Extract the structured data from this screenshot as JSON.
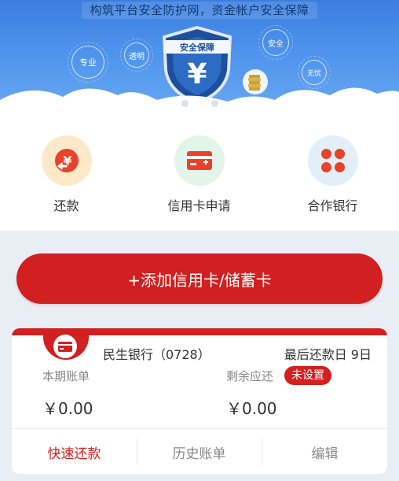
{
  "banner": {
    "title": "构筑平台安全防护网，资金帐户安全保障",
    "shield_text": "安全保障",
    "shield_symbol": "¥",
    "bubbles": [
      "专业",
      "透明",
      "安全",
      "无忧"
    ],
    "page_indicator": {
      "total": 3,
      "active": 1
    }
  },
  "menu": [
    {
      "label": "还款",
      "icon": "repay-icon",
      "icon_bg": "#fde9c8"
    },
    {
      "label": "信用卡申请",
      "icon": "credit-card-icon",
      "icon_bg": "#e3f4ea"
    },
    {
      "label": "合作银行",
      "icon": "partner-bank-icon",
      "icon_bg": "#e3eef8"
    }
  ],
  "add_card_label": "+添加信用卡/储蓄卡",
  "card": {
    "bank_name": "民生银行（0728）",
    "due_date": "最后还款日 9日",
    "bill_label": "本期账单",
    "bill_amount": "￥0.00",
    "remaining_label": "剩余应还",
    "remaining_badge": "未设置",
    "remaining_amount": "￥0.00",
    "actions": {
      "quick_repay": "快速还款",
      "history": "历史账单",
      "edit": "编辑"
    }
  },
  "colors": {
    "primary_red": "#d21f1f",
    "banner_blue": "#4e93ec",
    "page_bg": "#e9eef5"
  }
}
